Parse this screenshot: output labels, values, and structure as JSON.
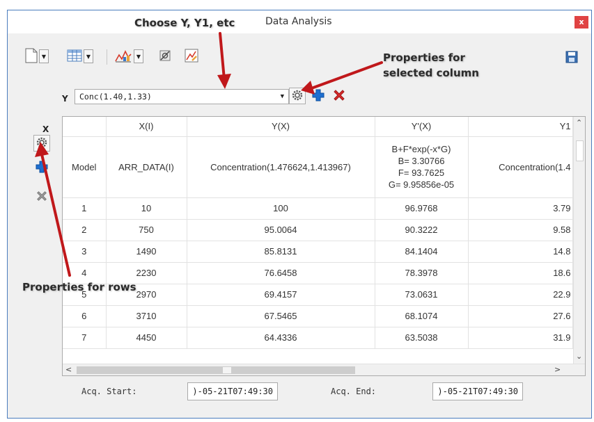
{
  "window": {
    "title": "Data Analysis",
    "close_label": "x"
  },
  "toolbar": {
    "icons": [
      "new-document-icon",
      "table-icon",
      "chart-icon",
      "tools-icon",
      "edit-chart-icon",
      "save-icon"
    ]
  },
  "y_selector": {
    "label": "Y",
    "value": "Conc(1.40,1.33)"
  },
  "x_panel": {
    "label": "X"
  },
  "grid": {
    "columns": [
      "",
      "X(I)",
      "Y(X)",
      "Y'(X)",
      "Y1"
    ],
    "model_row": {
      "label": "Model",
      "x": "ARR_DATA(I)",
      "y": "Concentration(1.476624,1.413967)",
      "yprime": [
        "B+F*exp(-x*G)",
        "B= 3.30766",
        "F= 93.7625",
        "G= 9.95856e-05"
      ],
      "y1": "Concentration(1.4"
    },
    "rows": [
      {
        "idx": "1",
        "x": "10",
        "y": "100",
        "yp": "96.9768",
        "y1": "3.79"
      },
      {
        "idx": "2",
        "x": "750",
        "y": "95.0064",
        "yp": "90.3222",
        "y1": "9.58"
      },
      {
        "idx": "3",
        "x": "1490",
        "y": "85.8131",
        "yp": "84.1404",
        "y1": "14.8"
      },
      {
        "idx": "4",
        "x": "2230",
        "y": "76.6458",
        "yp": "78.3978",
        "y1": "18.6"
      },
      {
        "idx": "5",
        "x": "2970",
        "y": "69.4157",
        "yp": "73.0631",
        "y1": "22.9"
      },
      {
        "idx": "6",
        "x": "3710",
        "y": "67.5465",
        "yp": "68.1074",
        "y1": "27.6"
      },
      {
        "idx": "7",
        "x": "4450",
        "y": "64.4336",
        "yp": "63.5038",
        "y1": "31.9"
      }
    ]
  },
  "acquisition": {
    "start_label": "Acq. Start:",
    "start_value": ")-05-21T07:49:30",
    "end_label": "Acq. End:",
    "end_value": ")-05-21T07:49:30"
  },
  "annotations": {
    "choose": "Choose Y, Y1, etc",
    "props_column_line1": "Properties for",
    "props_column_line2": "selected column",
    "props_rows": "Properties for rows"
  },
  "colors": {
    "window_border": "#4a7cbd",
    "close_button": "#e04343",
    "plus_blue": "#1e6fd0",
    "delete_red": "#d92b2b",
    "arrow_red": "#c0181b"
  }
}
